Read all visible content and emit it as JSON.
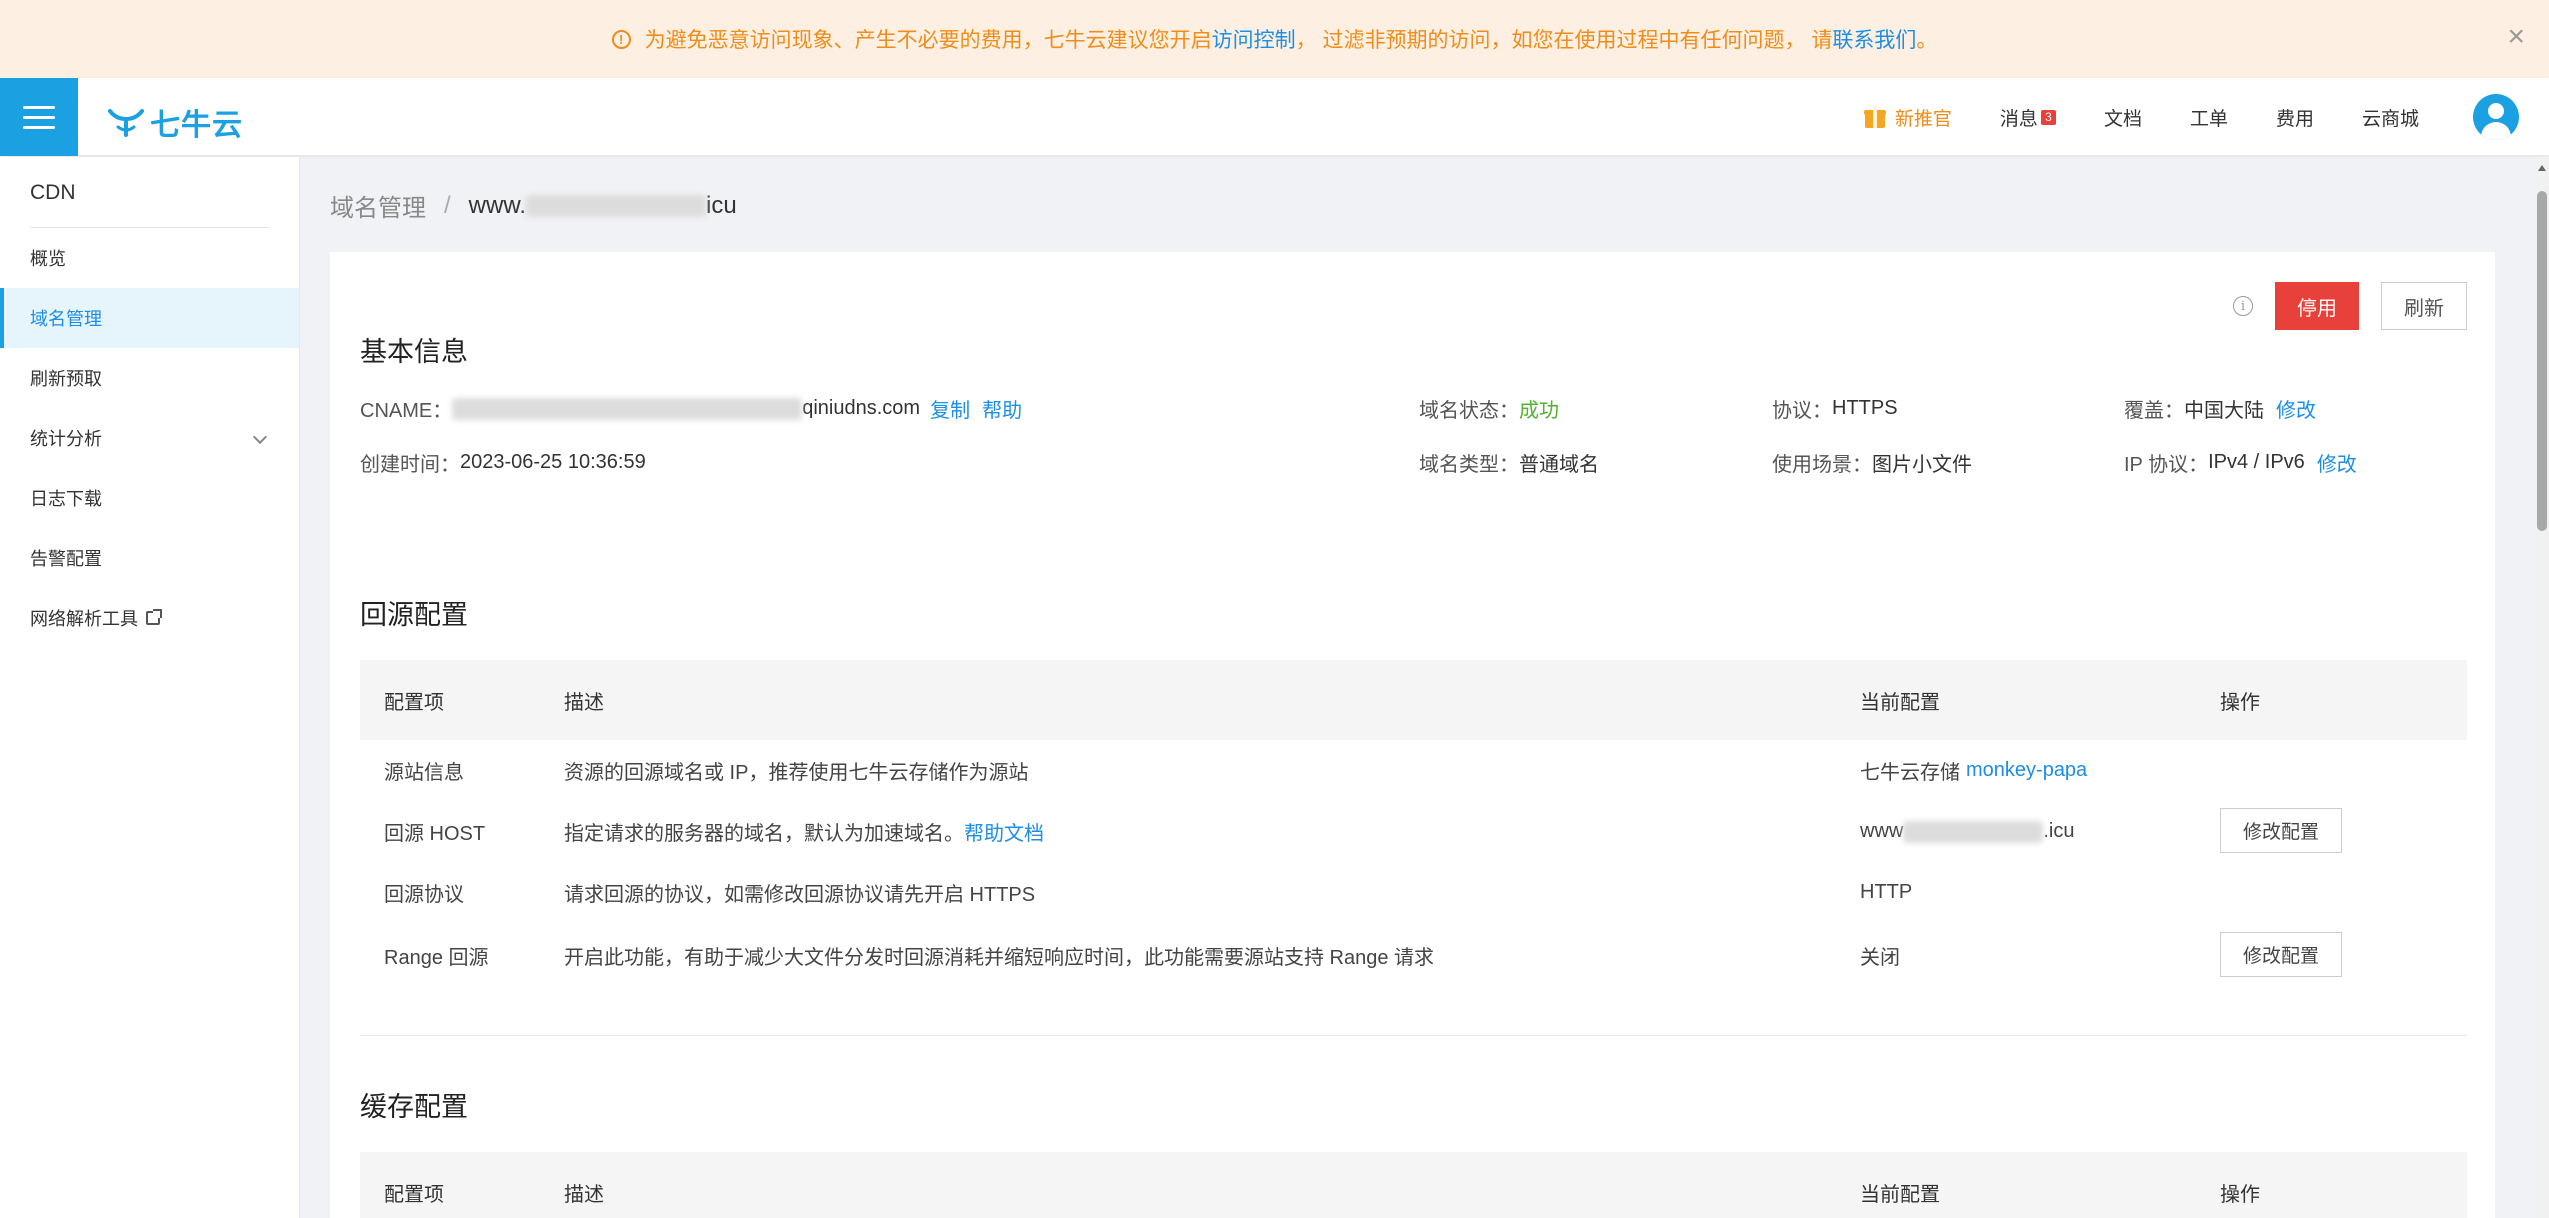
{
  "notice": {
    "text_before": "为避免恶意访问现象、产生不必要的费用，七牛云建议您开启",
    "link1": "访问控制",
    "text_middle": "，  过滤非预期的访问，如您在使用过程中有任何问题，  请",
    "link2": "联系我们",
    "text_after": "。",
    "close": "×"
  },
  "header": {
    "logo_text": "七牛云",
    "nav": {
      "promo": "新推官",
      "messages": "消息",
      "messages_count": "3",
      "docs": "文档",
      "tickets": "工单",
      "billing": "费用",
      "market": "云商城"
    }
  },
  "sidebar": {
    "title": "CDN",
    "items": [
      {
        "label": "概览"
      },
      {
        "label": "域名管理"
      },
      {
        "label": "刷新预取"
      },
      {
        "label": "统计分析"
      },
      {
        "label": "日志下载"
      },
      {
        "label": "告警配置"
      },
      {
        "label": "网络解析工具"
      }
    ]
  },
  "breadcrumb": {
    "parent": "域名管理",
    "sep": "/",
    "current_prefix": "www.",
    "current_suffix": "icu"
  },
  "actions": {
    "disable": "停用",
    "refresh": "刷新"
  },
  "basic": {
    "title": "基本信息",
    "cname_label": "CNAME：",
    "cname_suffix": "qiniudns.com",
    "copy": "复制",
    "help": "帮助",
    "created_label": "创建时间：",
    "created_value": "2023-06-25 10:36:59",
    "status_label": "域名状态：",
    "status_value": "成功",
    "type_label": "域名类型：",
    "type_value": "普通域名",
    "protocol_label": "协议：",
    "protocol_value": "HTTPS",
    "scene_label": "使用场景：",
    "scene_value": "图片小文件",
    "coverage_label": "覆盖：",
    "coverage_value": "中国大陆",
    "coverage_edit": "修改",
    "ip_label": "IP 协议：",
    "ip_value": "IPv4 / IPv6",
    "ip_edit": "修改"
  },
  "origin": {
    "title": "回源配置",
    "headers": [
      "配置项",
      "描述",
      "当前配置",
      "操作"
    ],
    "rows": [
      {
        "item": "源站信息",
        "desc": "资源的回源域名或 IP，推荐使用七牛云存储作为源站",
        "current_prefix": "七牛云存储 ",
        "current_link": "monkey-papa",
        "action": ""
      },
      {
        "item": "回源 HOST",
        "desc": "指定请求的服务器的域名，默认为加速域名。",
        "desc_link": "帮助文档",
        "current_prefix": "www",
        "current_suffix": ".icu",
        "action": "修改配置"
      },
      {
        "item": "回源协议",
        "desc": "请求回源的协议，如需修改回源协议请先开启 HTTPS",
        "current_prefix": "HTTP",
        "action": ""
      },
      {
        "item": "Range 回源",
        "desc": "开启此功能，有助于减少大文件分发时回源消耗并缩短响应时间，此功能需要源站支持 Range 请求",
        "current_prefix": "关闭",
        "action": "修改配置"
      }
    ]
  },
  "cache": {
    "title": "缓存配置",
    "headers": [
      "配置项",
      "描述",
      "当前配置",
      "操作"
    ]
  }
}
